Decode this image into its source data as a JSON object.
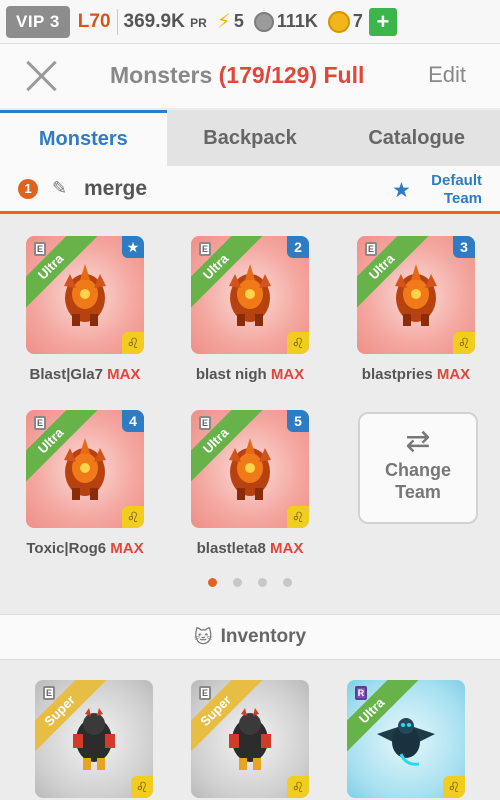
{
  "status": {
    "vip": "VIP 3",
    "level": "L70",
    "power": "369.9K",
    "power_unit": "PR",
    "energy": "5",
    "silver": "111K",
    "gold": "7",
    "plus": "+"
  },
  "header": {
    "title": "Monsters",
    "count": "(179/129) Full",
    "edit": "Edit"
  },
  "tabs": [
    "Monsters",
    "Backpack",
    "Catalogue"
  ],
  "team": {
    "number": "1",
    "name": "merge",
    "default_line1": "Default",
    "default_line2": "Team"
  },
  "team_monsters": [
    {
      "rarity": "Ultra",
      "slot": "★",
      "name": "Blast|Gla7",
      "max": "MAX"
    },
    {
      "rarity": "Ultra",
      "slot": "2",
      "name": "blast nigh",
      "max": "MAX"
    },
    {
      "rarity": "Ultra",
      "slot": "3",
      "name": "blastpries",
      "max": "MAX"
    },
    {
      "rarity": "Ultra",
      "slot": "4",
      "name": "Toxic|Rog6",
      "max": "MAX"
    },
    {
      "rarity": "Ultra",
      "slot": "5",
      "name": "blastleta8",
      "max": "MAX"
    }
  ],
  "change_team": {
    "line1": "Change",
    "line2": "Team"
  },
  "pagination": {
    "pages": 4,
    "current": 1
  },
  "inventory": {
    "title": "Inventory",
    "items": [
      {
        "rarity": "Super",
        "element": "E"
      },
      {
        "rarity": "Super",
        "element": "E"
      },
      {
        "rarity": "Ultra",
        "element": "R"
      }
    ]
  },
  "colors": {
    "accent_blue": "#2e7dc4",
    "accent_orange": "#e0621f",
    "max_red": "#e0473a"
  }
}
